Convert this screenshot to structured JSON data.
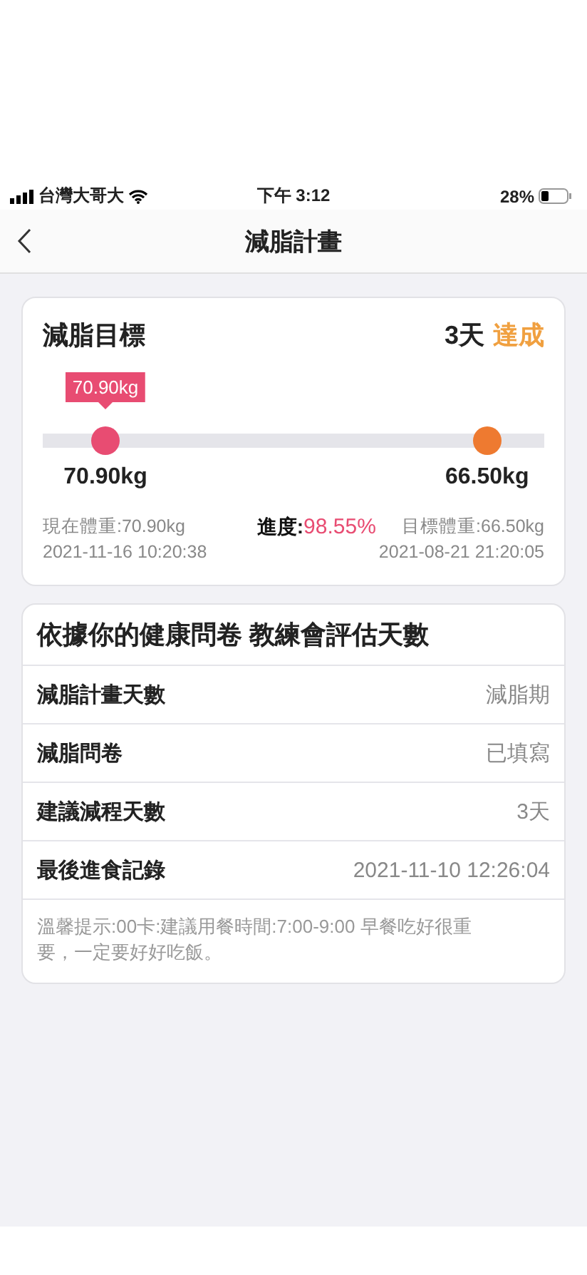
{
  "status_bar": {
    "carrier": "台灣大哥大",
    "time": "下午 3:12",
    "battery": "28%"
  },
  "nav": {
    "title": "減脂計畫"
  },
  "goal_card": {
    "title": "減脂目標",
    "days": "3天",
    "status": "達成",
    "tooltip": "70.90kg",
    "markers": [
      {
        "kind": "current",
        "level": 0.125,
        "label": "70.90kg"
      },
      {
        "kind": "target",
        "level": 0.886,
        "label": "66.50kg"
      }
    ],
    "current": {
      "label": "現在體重:70.90kg",
      "date": "2021-11-16 10:20:38"
    },
    "progress": {
      "label": "進度:",
      "value": "98.55%"
    },
    "target": {
      "label": "目標體重:66.50kg",
      "date": "2021-08-21 21:20:05"
    }
  },
  "info_card": {
    "title": "依據你的健康問卷 教練會評估天數",
    "rows": [
      {
        "label": "減脂計畫天數",
        "value": "減脂期"
      },
      {
        "label": "減脂問卷",
        "value": "已填寫"
      },
      {
        "label": "建議減程天數",
        "value": "3天"
      },
      {
        "label": "最後進食記錄",
        "value": "2021-11-10 12:26:04"
      }
    ],
    "note": "溫馨提示:00卡:建議用餐時間:7:00-9:00 早餐吃好很重要，一定要好好吃飯。"
  }
}
